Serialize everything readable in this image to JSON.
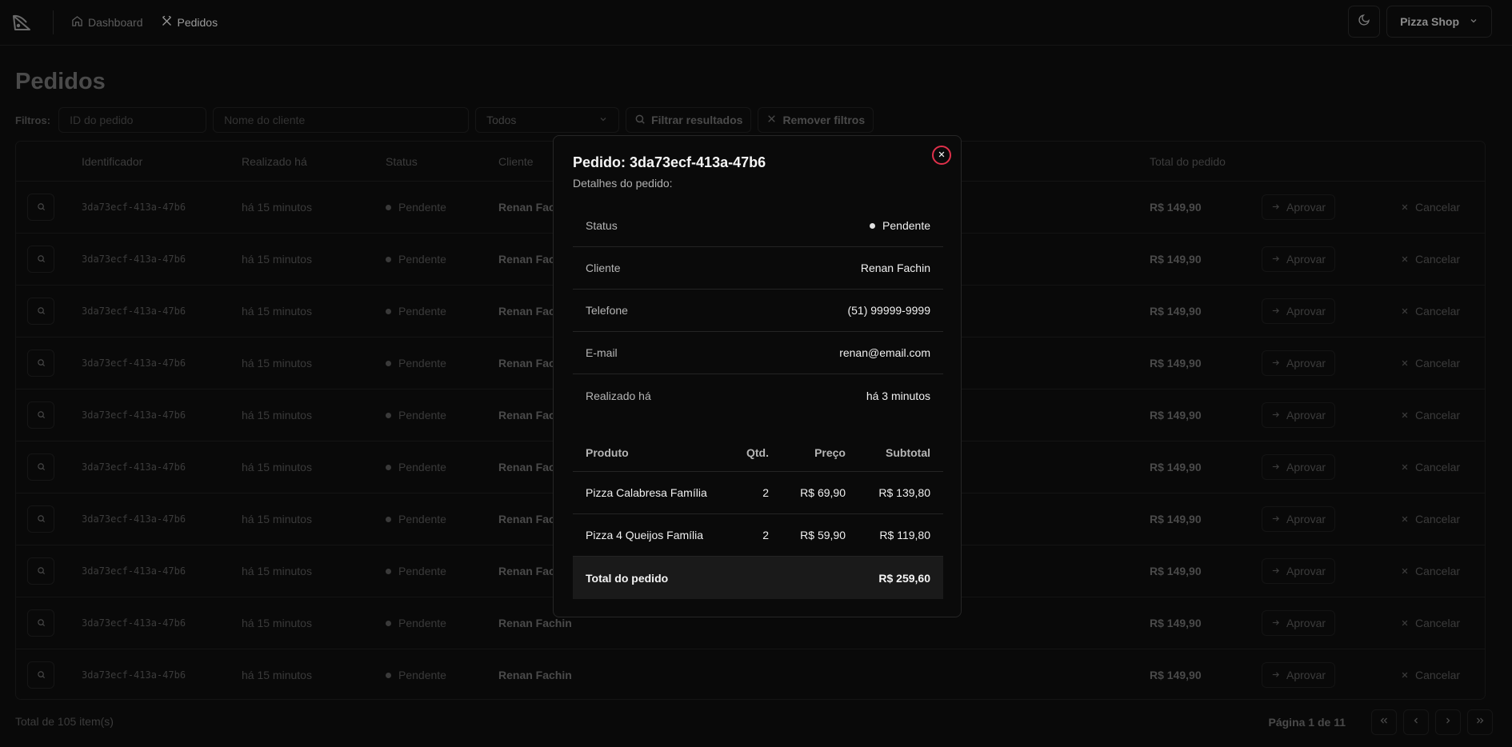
{
  "header": {
    "nav": [
      {
        "label": "Dashboard",
        "icon": "home-icon",
        "active": false
      },
      {
        "label": "Pedidos",
        "icon": "utensils-icon",
        "active": true
      }
    ],
    "shop_label": "Pizza Shop"
  },
  "page": {
    "title": "Pedidos",
    "filters": {
      "label": "Filtros:",
      "order_id_placeholder": "ID do pedido",
      "customer_placeholder": "Nome do cliente",
      "status_value": "Todos",
      "filter_button": "Filtrar resultados",
      "clear_button": "Remover filtros"
    }
  },
  "table": {
    "headers": [
      "Identificador",
      "Realizado há",
      "Status",
      "Cliente",
      "Total do pedido"
    ],
    "rows": [
      {
        "id": "3da73ecf-413a-47b6",
        "time": "há 15 minutos",
        "status": "Pendente",
        "customer": "Renan Fachin",
        "total": "R$ 149,90"
      },
      {
        "id": "3da73ecf-413a-47b6",
        "time": "há 15 minutos",
        "status": "Pendente",
        "customer": "Renan Fachin",
        "total": "R$ 149,90"
      },
      {
        "id": "3da73ecf-413a-47b6",
        "time": "há 15 minutos",
        "status": "Pendente",
        "customer": "Renan Fachin",
        "total": "R$ 149,90"
      },
      {
        "id": "3da73ecf-413a-47b6",
        "time": "há 15 minutos",
        "status": "Pendente",
        "customer": "Renan Fachin",
        "total": "R$ 149,90"
      },
      {
        "id": "3da73ecf-413a-47b6",
        "time": "há 15 minutos",
        "status": "Pendente",
        "customer": "Renan Fachin",
        "total": "R$ 149,90"
      },
      {
        "id": "3da73ecf-413a-47b6",
        "time": "há 15 minutos",
        "status": "Pendente",
        "customer": "Renan Fachin",
        "total": "R$ 149,90"
      },
      {
        "id": "3da73ecf-413a-47b6",
        "time": "há 15 minutos",
        "status": "Pendente",
        "customer": "Renan Fachin",
        "total": "R$ 149,90"
      },
      {
        "id": "3da73ecf-413a-47b6",
        "time": "há 15 minutos",
        "status": "Pendente",
        "customer": "Renan Fachin",
        "total": "R$ 149,90"
      },
      {
        "id": "3da73ecf-413a-47b6",
        "time": "há 15 minutos",
        "status": "Pendente",
        "customer": "Renan Fachin",
        "total": "R$ 149,90"
      },
      {
        "id": "3da73ecf-413a-47b6",
        "time": "há 15 minutos",
        "status": "Pendente",
        "customer": "Renan Fachin",
        "total": "R$ 149,90"
      }
    ],
    "approve_label": "Aprovar",
    "cancel_label": "Cancelar"
  },
  "footer": {
    "total_items": "Total de 105 item(s)",
    "page_info": "Página 1 de 11"
  },
  "modal": {
    "title": "Pedido: 3da73ecf-413a-47b6",
    "subtitle": "Detalhes do pedido:",
    "info": [
      {
        "label": "Status",
        "value": "Pendente"
      },
      {
        "label": "Cliente",
        "value": "Renan Fachin"
      },
      {
        "label": "Telefone",
        "value": "(51) 99999-9999"
      },
      {
        "label": "E-mail",
        "value": "renan@email.com"
      },
      {
        "label": "Realizado há",
        "value": "há 3 minutos"
      }
    ],
    "products_headers": {
      "product": "Produto",
      "qty": "Qtd.",
      "price": "Preço",
      "subtotal": "Subtotal"
    },
    "products": [
      {
        "name": "Pizza Calabresa Família",
        "qty": "2",
        "price": "R$ 69,90",
        "subtotal": "R$ 139,80"
      },
      {
        "name": "Pizza 4 Queijos Família",
        "qty": "2",
        "price": "R$ 59,90",
        "subtotal": "R$ 119,80"
      }
    ],
    "total_label": "Total do pedido",
    "total_value": "R$ 259,60"
  },
  "colors": {
    "background": "#090909",
    "close_accent": "#e0314b"
  }
}
